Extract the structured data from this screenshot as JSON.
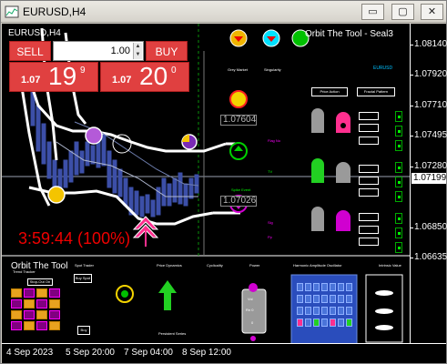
{
  "window": {
    "title": "EURUSD,H4",
    "min_glyph": "▭",
    "max_glyph": "▢",
    "close_glyph": "✕"
  },
  "chart": {
    "symbol_label": "EURUSD,H4",
    "tool_name": "Orbit The Tool - Seal3",
    "subwindow_title": "Orbit The Tool",
    "countdown": "3:59:44 (100%)",
    "level_upper": "1.07604",
    "level_lower": "1.07026",
    "current_price": "1.07199"
  },
  "trade_panel": {
    "sell_label": "SELL",
    "buy_label": "BUY",
    "lot_value": "1.00",
    "sell_small": "1.07",
    "sell_big": "19",
    "sell_sup": "9",
    "buy_small": "1.07",
    "buy_big": "20",
    "buy_sup": "0"
  },
  "price_axis": [
    "1.08140",
    "1.07920",
    "1.07710",
    "1.07495",
    "1.07280",
    "1.06850",
    "1.06635"
  ],
  "time_axis": [
    "4 Sep 2023",
    "5 Sep 20:00",
    "7 Sep 04:00",
    "8 Sep 12:00"
  ],
  "indicators": {
    "grey_market": "Grey Market",
    "singularity": "Singularity",
    "price_action": "Price Action",
    "fractal_pattern": "Fractal Pattern",
    "flag_no": "Flag No",
    "spike_event": "Spike Event",
    "buy_signal": "Buy",
    "tv_label": "TV",
    "sig_label": "Sig",
    "pp_label": "Pp",
    "eurusd_tag": "EURUSD"
  },
  "bottom_panel": {
    "sections": [
      "Trend Tracker",
      "Spot Trader",
      "Price Dynamics",
      "Cyclicality",
      "Power",
      "Harmonic Amplitude Oscillator",
      "Intrinsic Value"
    ],
    "ranging_label": "Stop-Out On",
    "spot_button": "Buy Spot",
    "buy_button": "Buy",
    "persistent_series": "Persistent Series",
    "power_val": "Vol",
    "power_row": "Rn 0",
    "power_bot": "0"
  },
  "colors": {
    "sell_red": "#e04040",
    "up_candle": "#3c4fa8",
    "band_white": "#ffffff",
    "accent_green": "#00ff00",
    "accent_magenta": "#ff00ff"
  }
}
